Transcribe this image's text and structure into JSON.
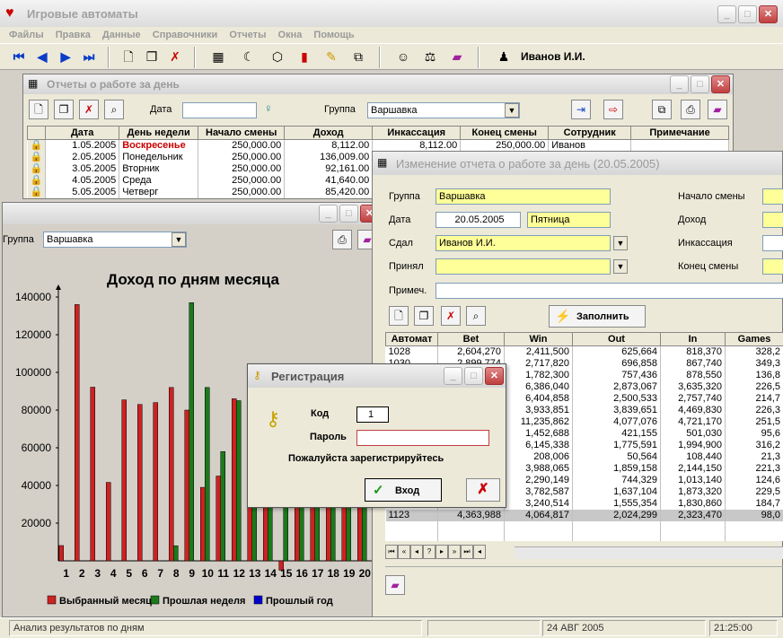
{
  "app": {
    "title": "Игровые автоматы",
    "menu": [
      "Файлы",
      "Правка",
      "Данные",
      "Справочники",
      "Отчеты",
      "Окна",
      "Помощь"
    ],
    "user": "Иванов И.И."
  },
  "reports_window": {
    "title": "Отчеты о работе за день",
    "date_label": "Дата",
    "date_value": "",
    "group_label": "Группа",
    "group_value": "Варшавка",
    "columns": [
      "Дата",
      "День недели",
      "Начало смены",
      "Доход",
      "Инкассация",
      "Конец смены",
      "Сотрудник",
      "Примечание"
    ],
    "rows": [
      {
        "date": "1.05.2005",
        "day": "Воскресенье",
        "start": "250,000.00",
        "income": "8,112.00",
        "collection": "8,112.00",
        "end": "250,000.00",
        "employee": "Иванов",
        "note": "",
        "holiday": true
      },
      {
        "date": "2.05.2005",
        "day": "Понедельник",
        "start": "250,000.00",
        "income": "136,009.00",
        "collection": "",
        "end": "",
        "employee": "",
        "note": "",
        "holiday": false
      },
      {
        "date": "3.05.2005",
        "day": "Вторник",
        "start": "250,000.00",
        "income": "92,161.00",
        "collection": "",
        "end": "",
        "employee": "",
        "note": "",
        "holiday": false
      },
      {
        "date": "4.05.2005",
        "day": "Среда",
        "start": "250,000.00",
        "income": "41,640.00",
        "collection": "",
        "end": "",
        "employee": "",
        "note": "",
        "holiday": false
      },
      {
        "date": "5.05.2005",
        "day": "Четверг",
        "start": "250,000.00",
        "income": "85,420.00",
        "collection": "",
        "end": "",
        "employee": "",
        "note": "",
        "holiday": false
      }
    ]
  },
  "chart_window": {
    "group_label": "Группа",
    "group_value": "Варшавка"
  },
  "chart_data": {
    "type": "bar",
    "title": "Доход по дням месяца",
    "xlabel": "",
    "ylabel": "",
    "ylim": [
      0,
      140000
    ],
    "yticks": [
      "20000",
      "40000",
      "60000",
      "80000",
      "100000",
      "120000",
      "140000"
    ],
    "categories": [
      "1",
      "2",
      "3",
      "4",
      "5",
      "6",
      "7",
      "8",
      "9",
      "10",
      "11",
      "12",
      "13",
      "14",
      "15",
      "16",
      "17",
      "18",
      "19",
      "20"
    ],
    "series": [
      {
        "name": "Выбранный месяц",
        "color": "#cc2222",
        "values": [
          8112,
          136009,
          92161,
          41640,
          85420,
          83000,
          84000,
          92000,
          80000,
          39000,
          45000,
          86000,
          68000,
          64000,
          -5000,
          65000,
          65000,
          55000,
          55000,
          55000
        ]
      },
      {
        "name": "Прошлая неделя",
        "color": "#1a7a1a",
        "values": [
          0,
          0,
          0,
          0,
          0,
          0,
          0,
          8000,
          137000,
          92000,
          58000,
          85000,
          46000,
          46000,
          48000,
          45000,
          43000,
          45000,
          45000,
          29000
        ]
      },
      {
        "name": "Прошлый год",
        "color": "#0000cc",
        "values": [
          0,
          0,
          0,
          0,
          0,
          0,
          0,
          0,
          0,
          0,
          0,
          0,
          0,
          0,
          0,
          0,
          0,
          0,
          0,
          0
        ]
      }
    ]
  },
  "edit_window": {
    "title": "Изменение отчета о работе за день  (20.05.2005)",
    "group_label": "Группа",
    "group_value": "Варшавка",
    "date_label": "Дата",
    "date_value": "20.05.2005",
    "day_value": "Пятница",
    "handed_label": "Сдал",
    "handed_value": "Иванов И.И.",
    "accepted_label": "Принял",
    "accepted_value": "",
    "note_label": "Примеч.",
    "note_value": "",
    "start_label": "Начало смены",
    "income_label": "Доход",
    "collection_label": "Инкассация",
    "end_label": "Конец смены",
    "fill_button": "Заполнить",
    "columns": [
      "Автомат",
      "Bet",
      "Win",
      "Out",
      "In",
      "Games"
    ],
    "rows": [
      [
        "1028",
        "2,604,270",
        "2,411,500",
        "625,664",
        "818,370",
        "328,2"
      ],
      [
        "1030",
        "2,899,774",
        "2,717,820",
        "696,858",
        "867,740",
        "349,3"
      ],
      [
        "",
        "",
        "1,782,300",
        "757,436",
        "878,550",
        "136,8"
      ],
      [
        "",
        "",
        "6,386,040",
        "2,873,067",
        "3,635,320",
        "226,5"
      ],
      [
        "",
        "",
        "6,404,858",
        "2,500,533",
        "2,757,740",
        "214,7"
      ],
      [
        "",
        "",
        "3,933,851",
        "3,839,651",
        "4,469,830",
        "226,3"
      ],
      [
        "",
        "",
        "11,235,862",
        "4,077,076",
        "4,721,170",
        "251,5"
      ],
      [
        "",
        "",
        "1,452,688",
        "421,155",
        "501,030",
        "95,6"
      ],
      [
        "",
        "",
        "6,145,338",
        "1,775,591",
        "1,994,900",
        "316,2"
      ],
      [
        "",
        "",
        "208,006",
        "50,564",
        "108,440",
        "21,3"
      ],
      [
        "",
        "",
        "3,988,065",
        "1,859,158",
        "2,144,150",
        "221,3"
      ],
      [
        "",
        "",
        "2,290,149",
        "744,329",
        "1,013,140",
        "124,6"
      ],
      [
        "",
        "",
        "3,782,587",
        "1,637,104",
        "1,873,320",
        "229,5"
      ],
      [
        "",
        "",
        "3,240,514",
        "1,555,354",
        "1,830,860",
        "184,7"
      ],
      [
        "1123",
        "4,363,988",
        "4,064,817",
        "2,024,299",
        "2,323,470",
        "98,0"
      ]
    ]
  },
  "login": {
    "title": "Регистрация",
    "code_label": "Код",
    "code_value": "1",
    "password_label": "Пароль",
    "password_value": "",
    "hint": "Пожалуйста зарегистрируйтесь",
    "ok_label": "Вход"
  },
  "status": {
    "left": "Анализ результатов по дням",
    "date": "24 АВГ 2005",
    "time": "21:25:00"
  }
}
